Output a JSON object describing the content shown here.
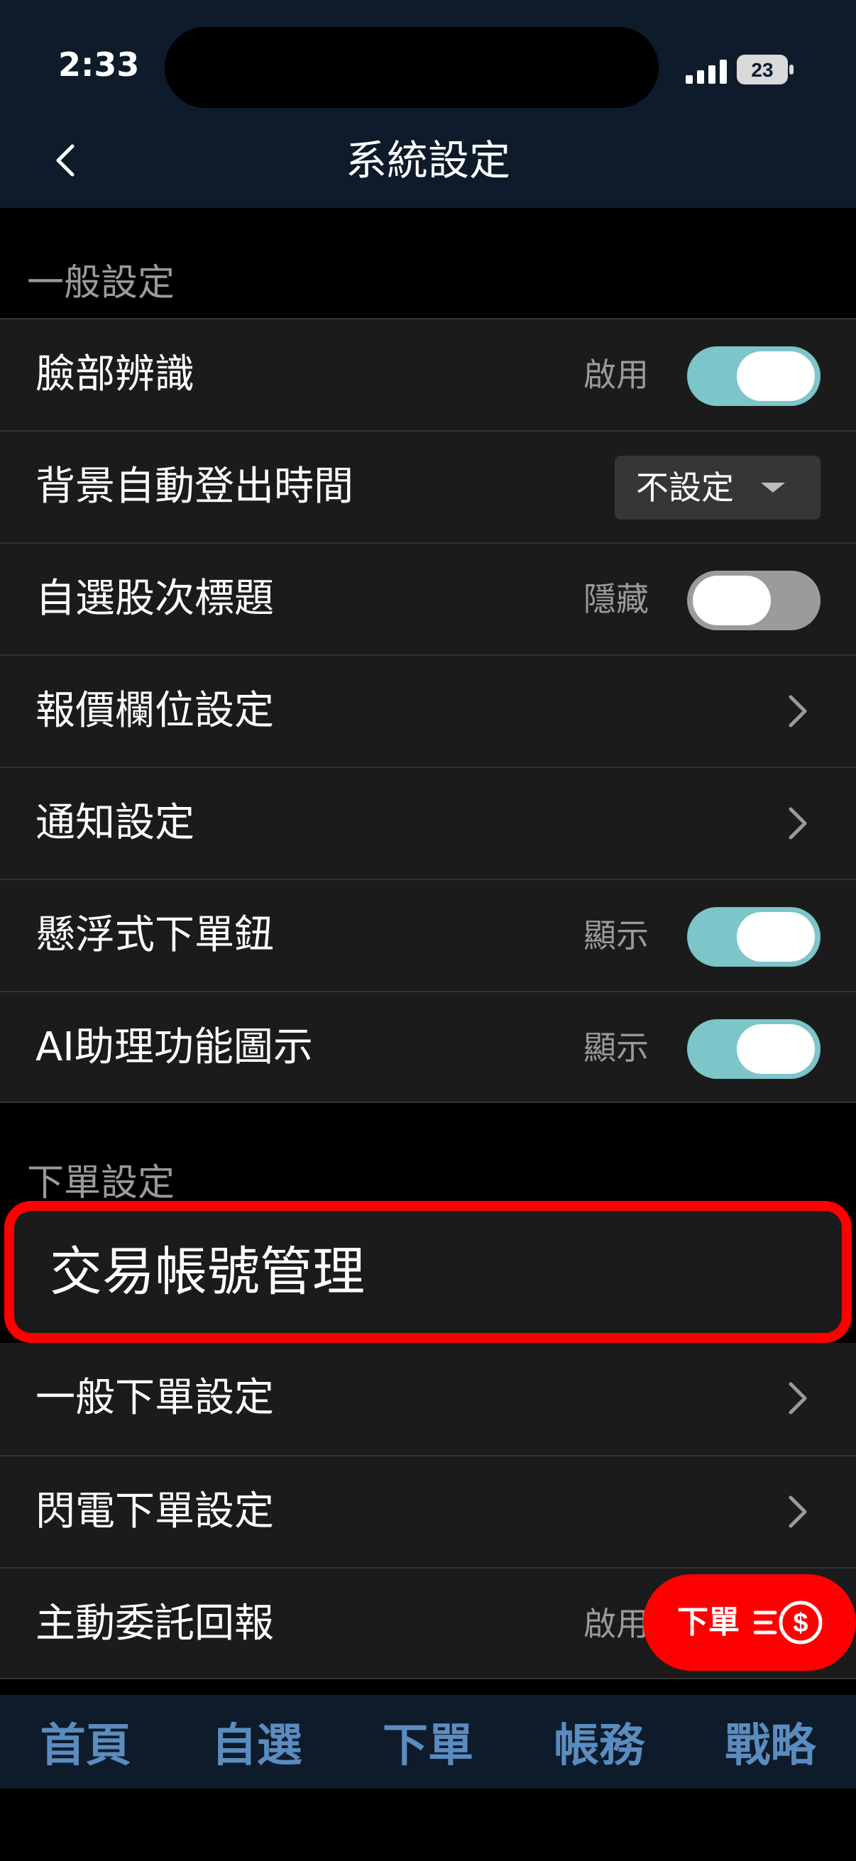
{
  "status_bar": {
    "time": "2:33",
    "battery": "23"
  },
  "header": {
    "title": "系統設定",
    "back_icon": "chevron-left-icon"
  },
  "sections": {
    "general": {
      "title": "一般設定",
      "rows": [
        {
          "label": "臉部辨識",
          "state": "啟用",
          "toggle": true
        },
        {
          "label": "背景自動登出時間",
          "select_value": "不設定"
        },
        {
          "label": "自選股次標題",
          "state": "隱藏",
          "toggle": false
        },
        {
          "label": "報價欄位設定"
        },
        {
          "label": "通知設定"
        },
        {
          "label": "懸浮式下單鈕",
          "state": "顯示",
          "toggle": true
        },
        {
          "label": "AI助理功能圖示",
          "state": "顯示",
          "toggle": true
        }
      ]
    },
    "order": {
      "title": "下單設定",
      "highlighted_item": "交易帳號管理",
      "rows": [
        {
          "label": "一般下單設定"
        },
        {
          "label": "閃電下單設定"
        },
        {
          "label": "主動委託回報",
          "state": "啟用"
        }
      ]
    }
  },
  "fab": {
    "label": "下單",
    "icon": "order-dollar-icon"
  },
  "tabbar": {
    "tabs": [
      "首頁",
      "自選",
      "下單",
      "帳務",
      "戰略"
    ]
  },
  "colors": {
    "header_bg": "#0d1b2a",
    "row_bg": "#1b1b1b",
    "toggle_on": "#7cc5c8",
    "toggle_off": "#9b9b9b",
    "highlight": "#ff0000",
    "tab_text": "#5b8cc0"
  }
}
